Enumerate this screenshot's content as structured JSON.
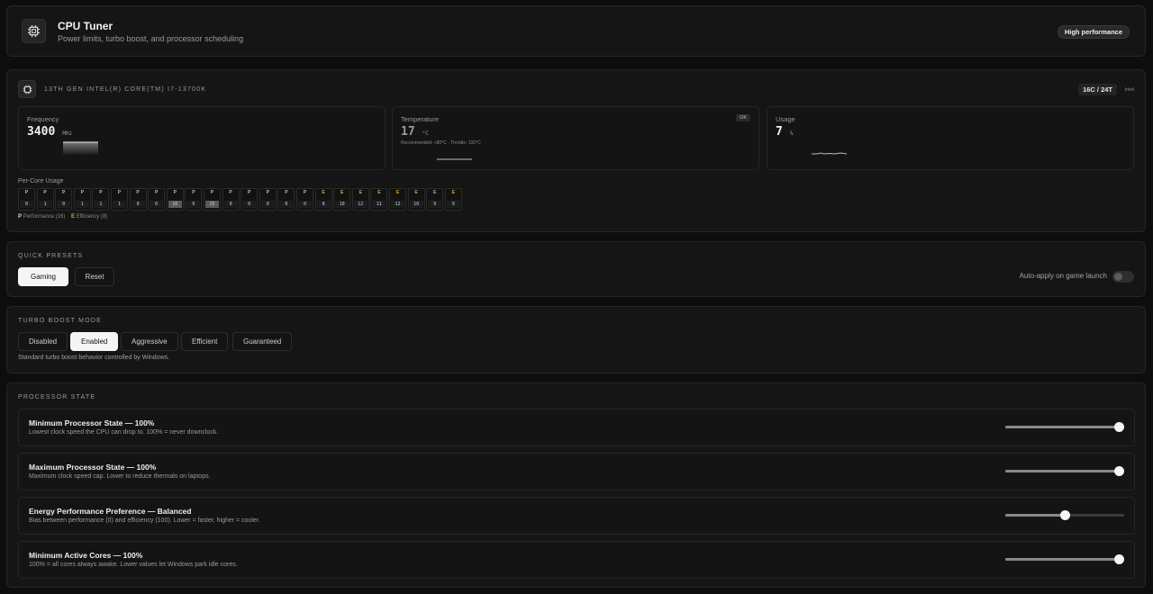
{
  "header": {
    "title": "CPU Tuner",
    "subtitle": "Power limits, turbo boost, and processor scheduling",
    "badge": "High performance",
    "icon": "cpu-icon"
  },
  "cpu": {
    "model": "13TH GEN INTEL(R) CORE(TM) I7-13700K",
    "cores_badge": "16C / 24T",
    "vendor": "Intel",
    "frequency": {
      "label": "Frequency",
      "value": "3400",
      "unit": "MHz"
    },
    "temperature": {
      "label": "Temperature",
      "value": "17",
      "unit": "°C",
      "status": "OK",
      "hint": "Recommended: <80°C · Throttle: 100°C"
    },
    "usage": {
      "label": "Usage",
      "value": "7",
      "unit": "%"
    },
    "per_core_label": "Per-Core Usage",
    "per_core": [
      {
        "type": "P",
        "value": "0"
      },
      {
        "type": "P",
        "value": "1"
      },
      {
        "type": "P",
        "value": "0"
      },
      {
        "type": "P",
        "value": "1"
      },
      {
        "type": "P",
        "value": "1"
      },
      {
        "type": "P",
        "value": "1"
      },
      {
        "type": "P",
        "value": "0"
      },
      {
        "type": "P",
        "value": "0"
      },
      {
        "type": "P",
        "value": "16"
      },
      {
        "type": "P",
        "value": "0"
      },
      {
        "type": "P",
        "value": "15"
      },
      {
        "type": "P",
        "value": "0"
      },
      {
        "type": "P",
        "value": "0"
      },
      {
        "type": "P",
        "value": "0"
      },
      {
        "type": "P",
        "value": "0"
      },
      {
        "type": "P",
        "value": "0"
      },
      {
        "type": "E",
        "value": "8"
      },
      {
        "type": "E",
        "value": "10"
      },
      {
        "type": "E",
        "value": "12"
      },
      {
        "type": "E",
        "value": "11"
      },
      {
        "type": "E",
        "value": "12"
      },
      {
        "type": "E",
        "value": "10"
      },
      {
        "type": "E",
        "value": "9"
      },
      {
        "type": "E",
        "value": "9"
      }
    ],
    "legend": {
      "p_key": "P",
      "p_label": "Performance (16)",
      "e_key": "E",
      "e_label": "Efficiency (8)"
    },
    "colors": {
      "efficiency": "#e8a13c"
    }
  },
  "presets": {
    "heading": "QUICK PRESETS",
    "buttons": [
      "Gaming",
      "Reset"
    ],
    "active": "Gaming",
    "auto_apply_label": "Auto-apply on game launch",
    "auto_apply_on": false
  },
  "turbo": {
    "heading": "TURBO BOOST MODE",
    "options": [
      "Disabled",
      "Enabled",
      "Aggressive",
      "Efficient",
      "Guaranteed"
    ],
    "active": "Enabled",
    "description": "Standard turbo boost behavior controlled by Windows."
  },
  "processor_state": {
    "heading": "PROCESSOR STATE",
    "rows": [
      {
        "title": "Minimum Processor State — 100%",
        "desc": "Lowest clock speed the CPU can drop to. 100% = never downclock.",
        "value_pct": 100
      },
      {
        "title": "Maximum Processor State — 100%",
        "desc": "Maximum clock speed cap. Lower to reduce thermals on laptops.",
        "value_pct": 100
      },
      {
        "title": "Energy Performance Preference — Balanced",
        "desc": "Bias between performance (0) and efficiency (100). Lower = faster, higher = cooler.",
        "value_pct": 50
      },
      {
        "title": "Minimum Active Cores — 100%",
        "desc": "100% = all cores always awake. Lower values let Windows park idle cores.",
        "value_pct": 100
      }
    ]
  }
}
